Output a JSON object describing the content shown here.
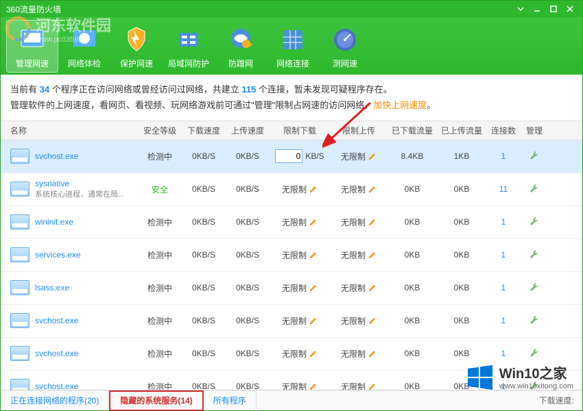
{
  "window": {
    "title": "360流量防火墙"
  },
  "toolbar": [
    {
      "label": "管理网速",
      "active": true
    },
    {
      "label": "网络体检"
    },
    {
      "label": "保护网速"
    },
    {
      "label": "局域网防护"
    },
    {
      "label": "防蹭网"
    },
    {
      "label": "网络连接"
    },
    {
      "label": "测网速"
    }
  ],
  "info": {
    "line1_a": "当前有 ",
    "num1": "34",
    "line1_b": " 个程序正在访问网络或曾经访问过网络，共建立 ",
    "num2": "115",
    "line1_c": " 个连接，暂未发现可疑程序存在。",
    "line2_a": "管理软件的上网速度，看网页、看视频、玩网络游戏前可通过\"管理\"限制占网速的访问网络，",
    "line2_hl": "加快上网速度",
    "line2_b": "。"
  },
  "columns": {
    "name": "名称",
    "safety": "安全等级",
    "down": "下载速度",
    "up": "上传速度",
    "limdown": "限制下载",
    "limup": "限制上传",
    "dled": "已下载流量",
    "uled": "已上传流量",
    "conn": "连接数",
    "mgmt": "管理"
  },
  "rows": [
    {
      "name": "svchost.exe",
      "sub": "",
      "safety": "检测中",
      "safeClass": "",
      "down": "0KB/S",
      "up": "0KB/S",
      "limdown_input": "0",
      "limdown_unit": "KB/S",
      "limup": "无限制",
      "dled": "8.4KB",
      "uled": "1KB",
      "conn": "1",
      "selected": true
    },
    {
      "name": "sysnative",
      "sub": "系统核心进程，通常在局...",
      "safety": "安全",
      "safeClass": "safe-green",
      "down": "0KB/S",
      "up": "0KB/S",
      "limdown": "无限制",
      "limup": "无限制",
      "dled": "0KB",
      "uled": "0KB",
      "conn": "11"
    },
    {
      "name": "wininit.exe",
      "sub": "",
      "safety": "检测中",
      "safeClass": "",
      "down": "0KB/S",
      "up": "0KB/S",
      "limdown": "无限制",
      "limup": "无限制",
      "dled": "0KB",
      "uled": "0KB",
      "conn": "1"
    },
    {
      "name": "services.exe",
      "sub": "",
      "safety": "检测中",
      "safeClass": "",
      "down": "0KB/S",
      "up": "0KB/S",
      "limdown": "无限制",
      "limup": "无限制",
      "dled": "0KB",
      "uled": "0KB",
      "conn": "1"
    },
    {
      "name": "lsass.exe",
      "sub": "",
      "safety": "检测中",
      "safeClass": "",
      "down": "0KB/S",
      "up": "0KB/S",
      "limdown": "无限制",
      "limup": "无限制",
      "dled": "0KB",
      "uled": "0KB",
      "conn": "1"
    },
    {
      "name": "svchost.exe",
      "sub": "",
      "safety": "检测中",
      "safeClass": "",
      "down": "0KB/S",
      "up": "0KB/S",
      "limdown": "无限制",
      "limup": "无限制",
      "dled": "0KB",
      "uled": "0KB",
      "conn": "1"
    },
    {
      "name": "svchost.exe",
      "sub": "",
      "safety": "检测中",
      "safeClass": "",
      "down": "0KB/S",
      "up": "0KB/S",
      "limdown": "无限制",
      "limup": "无限制",
      "dled": "0KB",
      "uled": "0KB",
      "conn": "1"
    },
    {
      "name": "svchost.exe",
      "sub": "",
      "safety": "检测中",
      "safeClass": "",
      "down": "0KB/S",
      "up": "0KB/S",
      "limdown": "无限制",
      "limup": "无限制",
      "dled": "0KB",
      "uled": "0KB",
      "conn": "1"
    }
  ],
  "tabs": [
    {
      "label": "正在连接网络的程序(20)"
    },
    {
      "label": "隐藏的系统服务(14)",
      "active": true
    },
    {
      "label": "所有程序"
    }
  ],
  "bottom_right": "下载速度:",
  "watermark_top": {
    "main": "河东软件园",
    "sub": "www.pc0359.cn"
  },
  "watermark_bottom": {
    "main": "Win10之家",
    "sub": "www.win10xitong.com"
  }
}
